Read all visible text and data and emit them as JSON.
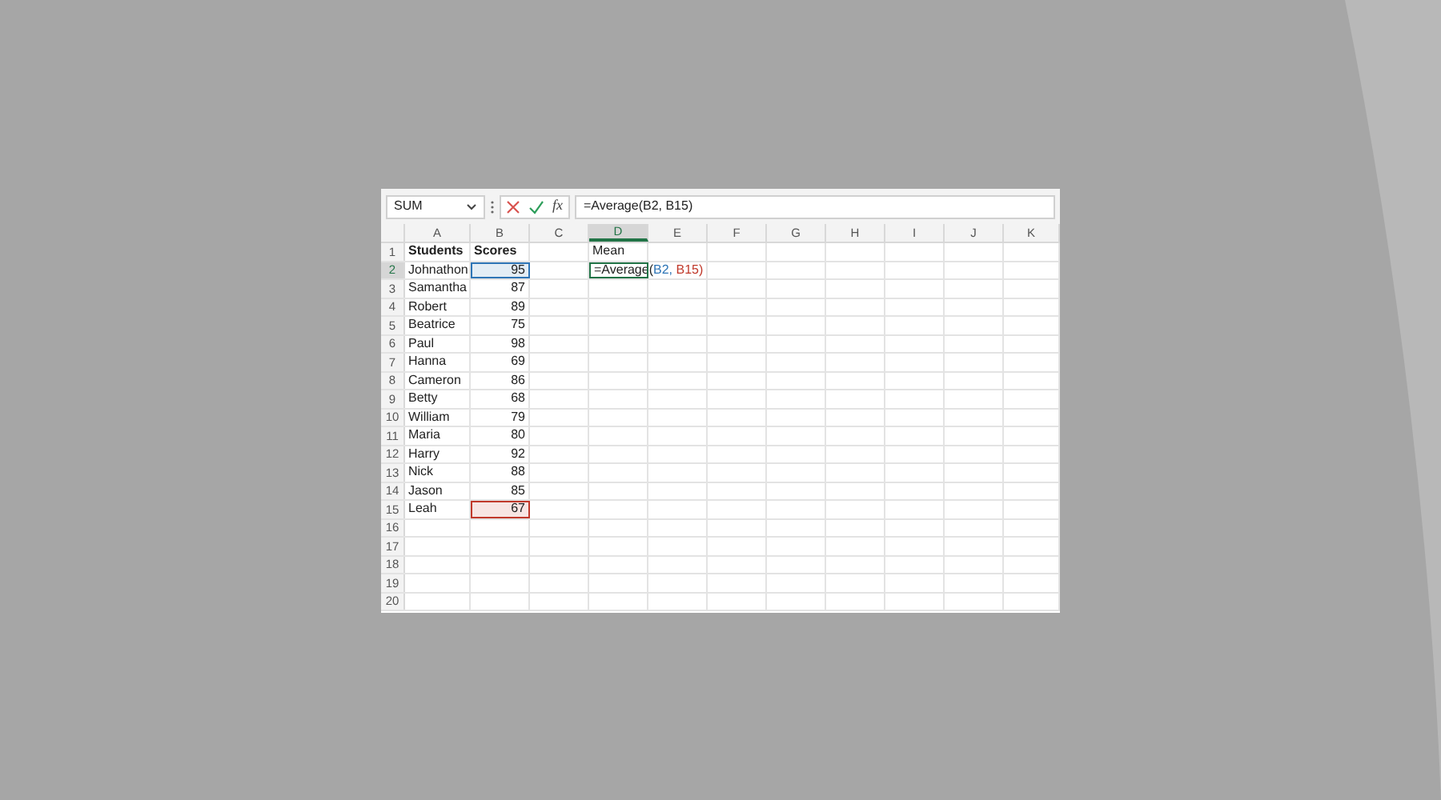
{
  "formula_bar": {
    "name_box": "SUM",
    "function_button": "fx",
    "formula": "=Average(B2, B15)"
  },
  "columns": [
    {
      "label": "A",
      "selected": false
    },
    {
      "label": "B",
      "selected": false
    },
    {
      "label": "C",
      "selected": false
    },
    {
      "label": "D",
      "selected": true
    },
    {
      "label": "E",
      "selected": false
    },
    {
      "label": "F",
      "selected": false
    },
    {
      "label": "G",
      "selected": false
    },
    {
      "label": "H",
      "selected": false
    },
    {
      "label": "I",
      "selected": false
    },
    {
      "label": "J",
      "selected": false
    },
    {
      "label": "K",
      "selected": false
    }
  ],
  "rows": [
    {
      "number": "1",
      "selected": false,
      "a": {
        "text": "Students",
        "bold": true
      },
      "b": {
        "text": "Scores",
        "bold": true
      },
      "d": {
        "text": "Mean",
        "bold": false
      }
    },
    {
      "number": "2",
      "selected": true,
      "a": {
        "text": "Johnathon"
      },
      "b": {
        "text": "95",
        "kind": "number",
        "color": "#2e75b6"
      },
      "d": {
        "active": true,
        "segments": [
          {
            "text": "=Average("
          },
          {
            "text": "B2,",
            "color": "#2e75b6"
          },
          {
            "text": " B15)",
            "color": "#c0392b"
          }
        ]
      }
    },
    {
      "number": "3",
      "selected": false,
      "a": {
        "text": "Samantha"
      },
      "b": {
        "text": "87",
        "kind": "number"
      }
    },
    {
      "number": "4",
      "selected": false,
      "a": {
        "text": "Robert"
      },
      "b": {
        "text": "89",
        "kind": "number"
      }
    },
    {
      "number": "5",
      "selected": false,
      "a": {
        "text": "Beatrice"
      },
      "b": {
        "text": "75",
        "kind": "number"
      }
    },
    {
      "number": "6",
      "selected": false,
      "a": {
        "text": "Paul"
      },
      "b": {
        "text": "98",
        "kind": "number"
      }
    },
    {
      "number": "7",
      "selected": false,
      "a": {
        "text": "Hanna"
      },
      "b": {
        "text": "69",
        "kind": "number"
      }
    },
    {
      "number": "8",
      "selected": false,
      "a": {
        "text": "Cameron"
      },
      "b": {
        "text": "86",
        "kind": "number"
      }
    },
    {
      "number": "9",
      "selected": false,
      "a": {
        "text": "Betty"
      },
      "b": {
        "text": "68",
        "kind": "number"
      }
    },
    {
      "number": "10",
      "selected": false,
      "a": {
        "text": "William"
      },
      "b": {
        "text": "79",
        "kind": "number"
      }
    },
    {
      "number": "11",
      "selected": false,
      "a": {
        "text": "Maria"
      },
      "b": {
        "text": "80",
        "kind": "number"
      }
    },
    {
      "number": "12",
      "selected": false,
      "a": {
        "text": "Harry"
      },
      "b": {
        "text": "92",
        "kind": "number"
      }
    },
    {
      "number": "13",
      "selected": false,
      "a": {
        "text": "Nick"
      },
      "b": {
        "text": "88",
        "kind": "number"
      }
    },
    {
      "number": "14",
      "selected": false,
      "a": {
        "text": "Jason"
      },
      "b": {
        "text": "85",
        "kind": "number"
      }
    },
    {
      "number": "15",
      "selected": false,
      "a": {
        "text": "Leah"
      },
      "b": {
        "text": "67",
        "kind": "number",
        "color": "#c0392b"
      }
    },
    {
      "number": "16",
      "selected": false
    },
    {
      "number": "17",
      "selected": false
    },
    {
      "number": "18",
      "selected": false
    },
    {
      "number": "19",
      "selected": false
    },
    {
      "number": "20",
      "selected": false
    }
  ]
}
